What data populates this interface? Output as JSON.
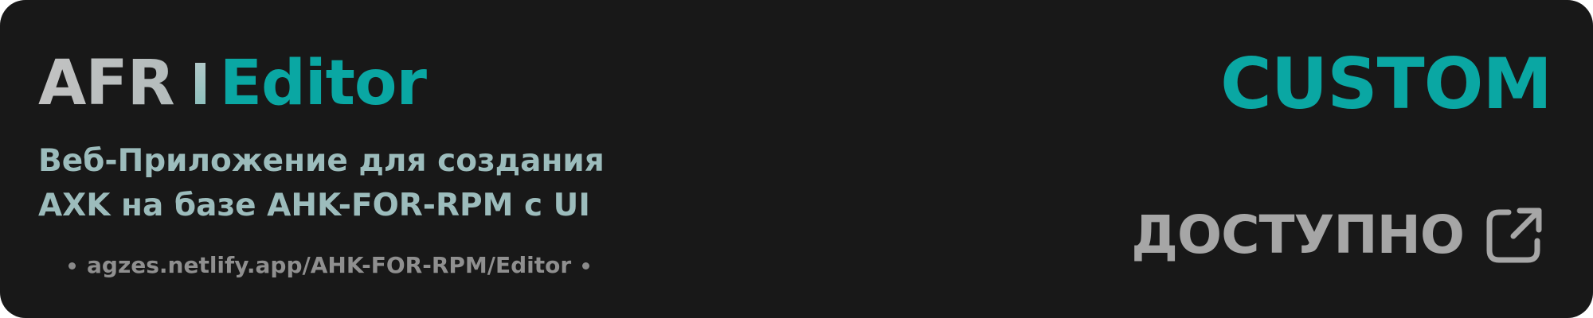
{
  "banner": {
    "title_part1": "AFR",
    "title_separator": "|",
    "title_part2": "Editor",
    "badge": "CUSTOM",
    "description_line1": "Веб-Приложение для создания",
    "description_line2": "AXK на базе AHK-FOR-RPM с UI",
    "url": "agzes.netlify.app/AHK-FOR-RPM/Editor",
    "availability": "ДОСТУПНО",
    "availability_icon": "external-link-icon"
  },
  "colors": {
    "background": "#181818",
    "accent": "#0aa7a3",
    "description": "#9cbcbc",
    "muted": "#8a8a8a",
    "availability": "#a6a6a6"
  }
}
